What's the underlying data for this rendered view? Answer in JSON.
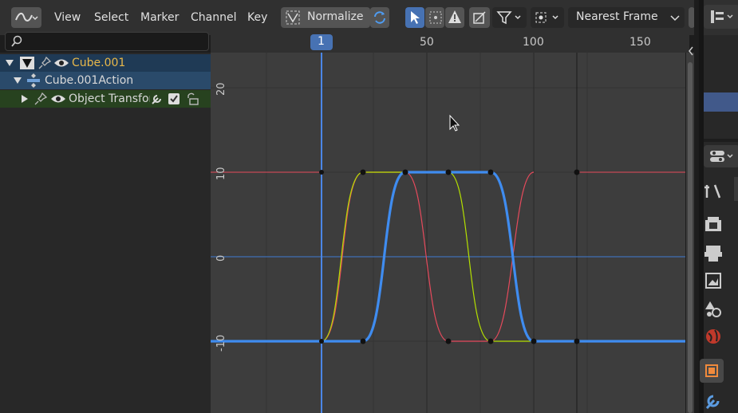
{
  "header": {
    "menu": [
      "View",
      "Select",
      "Marker",
      "Channel",
      "Key"
    ],
    "normalize_label": "Normalize",
    "snap_mode": "Nearest Frame"
  },
  "ruler": {
    "current_frame": "1",
    "ticks": [
      "50",
      "100",
      "150"
    ]
  },
  "channels": [
    {
      "label": "Cube.001",
      "color": "#e8b84a"
    },
    {
      "label": "Cube.001Action",
      "color": "#d8d8d8"
    },
    {
      "label": "Object Transform",
      "color": "#d8d8d8"
    }
  ],
  "graph": {
    "y_labels": [
      "20",
      "10",
      "0",
      "-10"
    ]
  },
  "colors": {
    "accent": "#4772b3",
    "curve_blue": "#3f8cf0",
    "curve_red": "#e64a5c",
    "curve_green": "#b4e000",
    "channel_row_selected": "#2b4a6b",
    "transform_row": "#2b4a2b"
  }
}
